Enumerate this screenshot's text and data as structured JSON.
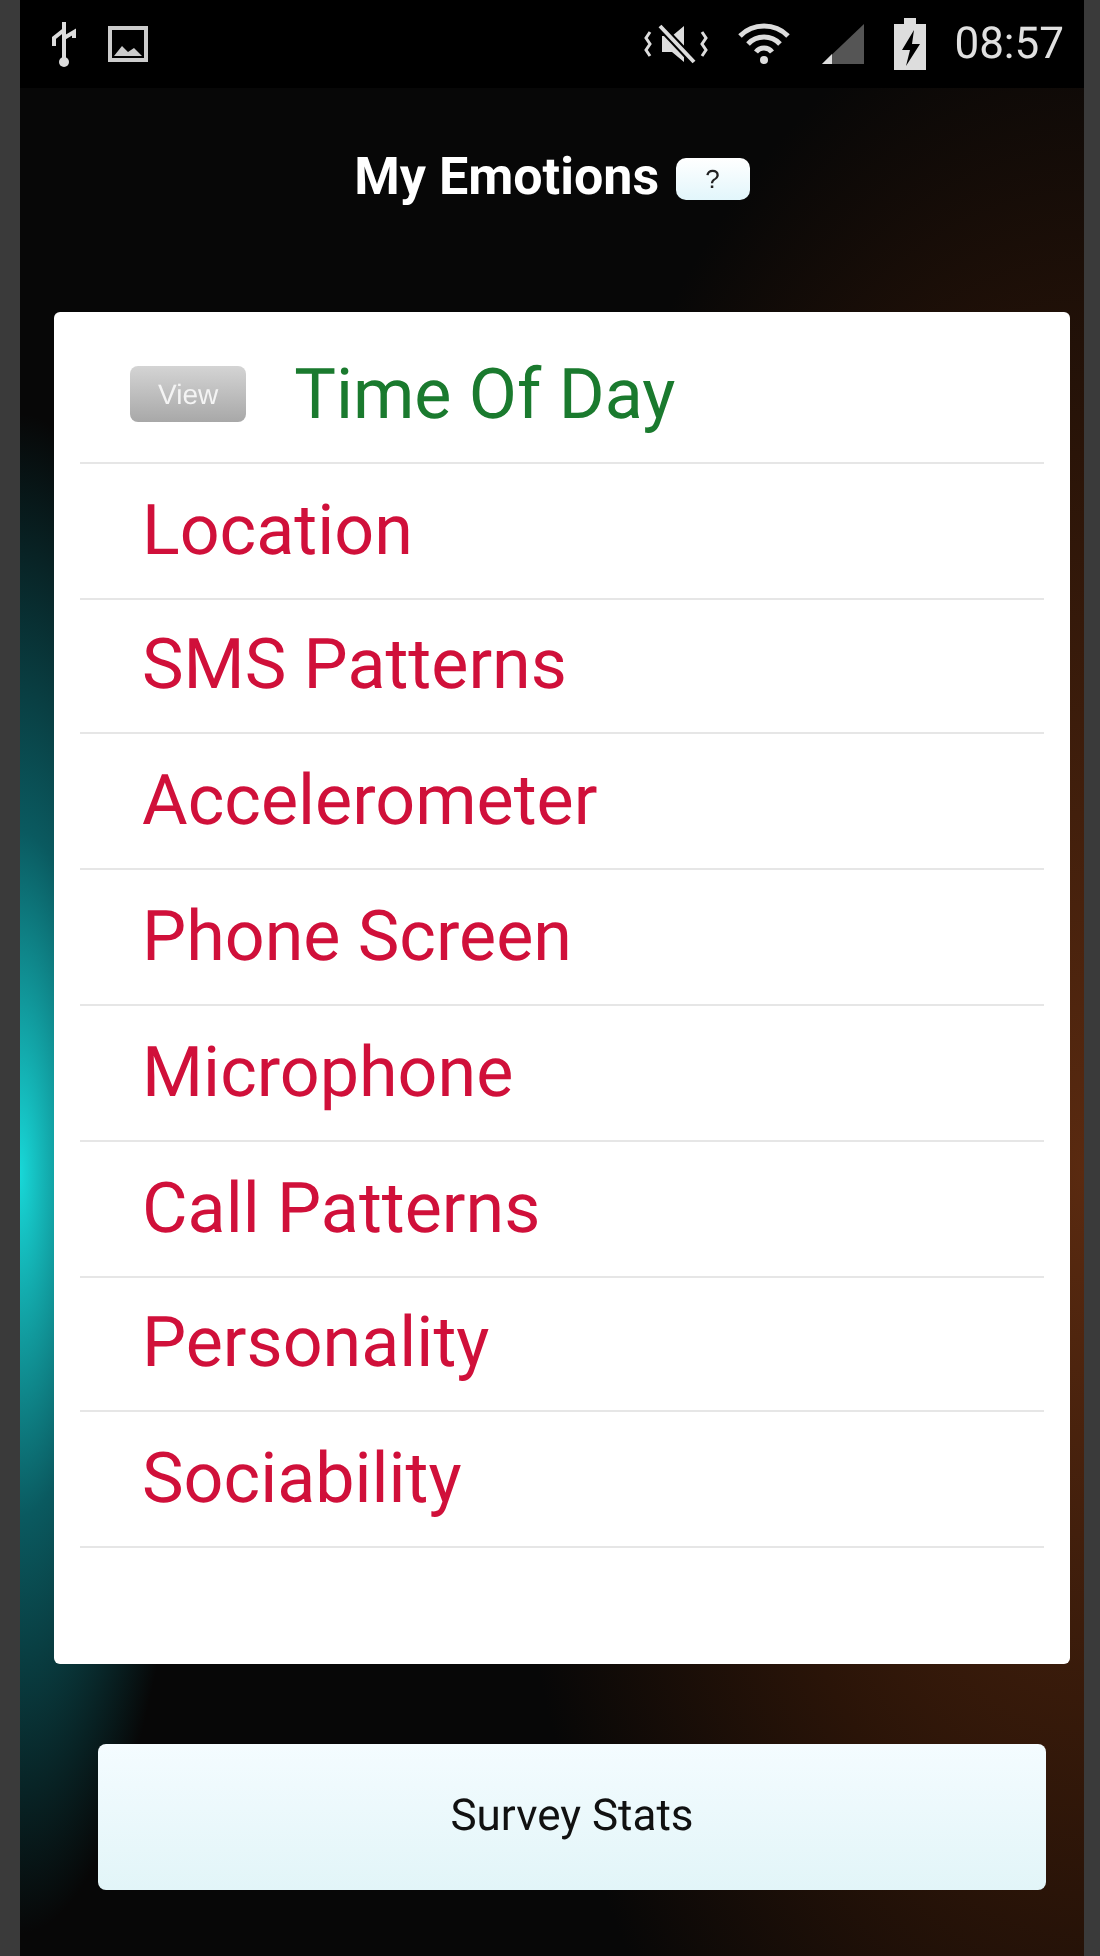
{
  "status_bar": {
    "time": "08:57"
  },
  "header": {
    "title": "My Emotions",
    "help_button": "?"
  },
  "items": [
    {
      "label": "Time Of Day",
      "completed": true,
      "action": "View"
    },
    {
      "label": "Location",
      "completed": false
    },
    {
      "label": "SMS Patterns",
      "completed": false
    },
    {
      "label": "Accelerometer",
      "completed": false
    },
    {
      "label": "Phone Screen",
      "completed": false
    },
    {
      "label": "Microphone",
      "completed": false
    },
    {
      "label": "Call Patterns",
      "completed": false
    },
    {
      "label": "Personality",
      "completed": false
    },
    {
      "label": "Sociability",
      "completed": false
    }
  ],
  "footer_button": "Survey Stats"
}
